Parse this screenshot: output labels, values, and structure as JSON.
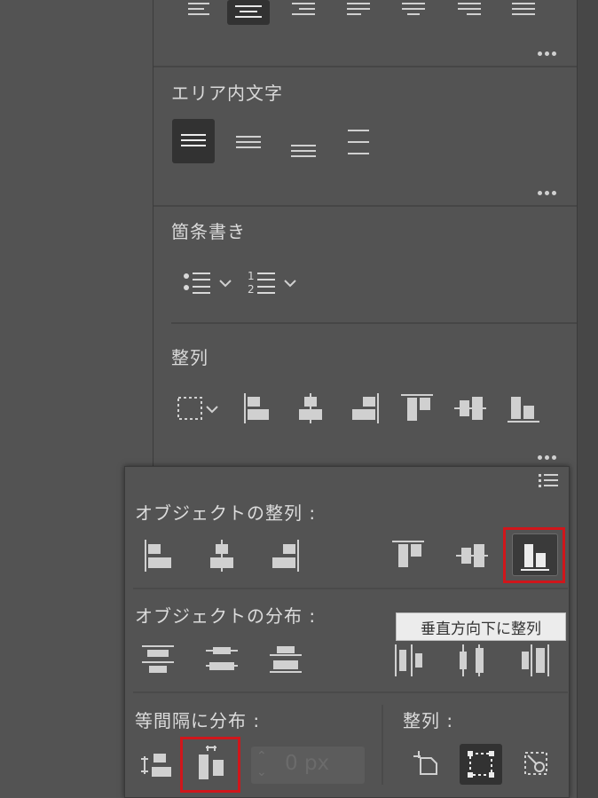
{
  "area_text": {
    "title": "エリア内文字"
  },
  "bullets": {
    "title": "箇条書き",
    "numbered_label_1": "1",
    "numbered_label_2": "2"
  },
  "align": {
    "title": "整列"
  },
  "popup": {
    "object_align_title": "オブジェクトの整列 :",
    "object_distribute_title": "オブジェクトの分布 :",
    "spacing_title": "等間隔に分布 :",
    "align_to_title": "整列 :",
    "spacing_value": "0 px",
    "tooltip": "垂直方向下に整列"
  },
  "colors": {
    "highlight": "#d0161b",
    "active_bg": "#323232",
    "panel_bg": "#535353"
  }
}
